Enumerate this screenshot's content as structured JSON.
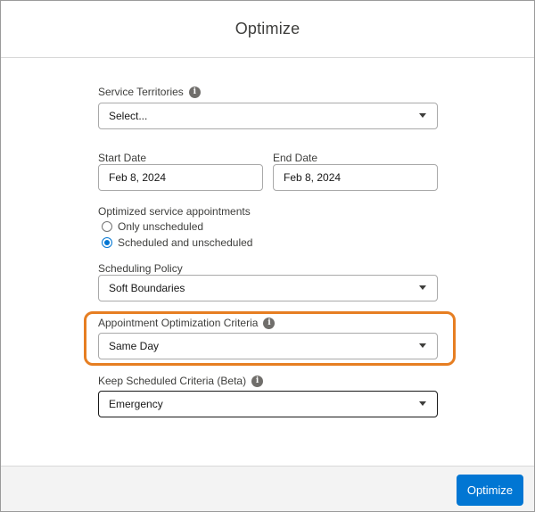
{
  "modal": {
    "title": "Optimize"
  },
  "fields": {
    "service_territories": {
      "label": "Service Territories",
      "value": "Select...",
      "info_icon": "info-icon"
    },
    "start_date": {
      "label": "Start Date",
      "value": "Feb 8, 2024"
    },
    "end_date": {
      "label": "End Date",
      "value": "Feb 8, 2024"
    },
    "optimized_appointments": {
      "label": "Optimized service appointments",
      "options": [
        {
          "label": "Only unscheduled",
          "checked": false
        },
        {
          "label": "Scheduled and unscheduled",
          "checked": true
        }
      ]
    },
    "scheduling_policy": {
      "label": "Scheduling Policy",
      "value": "Soft Boundaries"
    },
    "appointment_optimization_criteria": {
      "label": "Appointment Optimization Criteria",
      "value": "Same Day",
      "info_icon": "info-icon"
    },
    "keep_scheduled_criteria": {
      "label": "Keep Scheduled Criteria (Beta)",
      "value": "Emergency",
      "info_icon": "info-icon"
    }
  },
  "footer": {
    "optimize_label": "Optimize"
  },
  "colors": {
    "brand": "#0176d3",
    "highlight": "#e67e22"
  }
}
